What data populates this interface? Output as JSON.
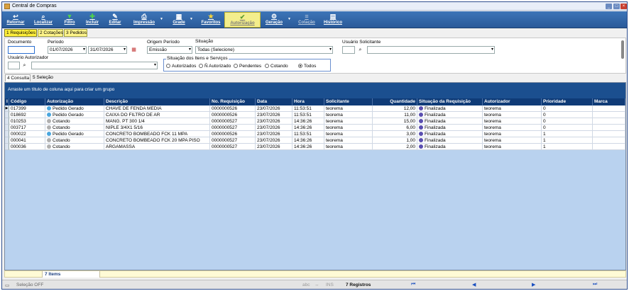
{
  "window": {
    "title": "Central de Compras"
  },
  "toolbar": {
    "items": [
      {
        "label": "Retornar",
        "icon": "return-icon"
      },
      {
        "label": "Localizar",
        "icon": "search-icon"
      },
      {
        "label": "Filtro",
        "icon": "filter-icon"
      },
      {
        "label": "Incluir",
        "icon": "add-icon"
      },
      {
        "label": "Editar",
        "icon": "edit-icon"
      },
      {
        "label": "Impressão",
        "icon": "print-icon"
      },
      {
        "label": "Grade",
        "icon": "grid-icon"
      },
      {
        "label": "Favoritos",
        "icon": "star-icon"
      },
      {
        "label": "Autorização",
        "icon": "authorization-icon"
      },
      {
        "label": "Geração",
        "icon": "generate-icon"
      },
      {
        "label": "Cotação",
        "icon": "quote-icon"
      },
      {
        "label": "Histórico",
        "icon": "history-icon"
      }
    ]
  },
  "tabs": [
    "1 Requisições",
    "2 Cotações",
    "3 Pedidos"
  ],
  "filters": {
    "documento_label": "Documento",
    "periodo_label": "Período",
    "date_from": "01/07/2026",
    "date_to": "31/07/2026",
    "origem_label": "Origem Período",
    "origem_value": "Emissão",
    "situacao_label": "Situação",
    "situacao_value": "Todas (Selecione)",
    "usuario_solicitante_label": "Usuário Solicitante",
    "usuario_autorizador_label": "Usuário Autorizador",
    "situacao_itens_label": "Situação dos Itens e Serviços",
    "radios": [
      "Autorizados",
      "Ñ Autorizado",
      "Pendentes",
      "Cotando",
      "Todos"
    ],
    "radio_selected": "Todos"
  },
  "subtabs": [
    "4 Consulta",
    "5 Seleção"
  ],
  "grid": {
    "group_hint": "Arraste um título de coluna aqui para criar um grupo",
    "columns": [
      "Código",
      "Autorização",
      "Descrição",
      "No. Requisição",
      "Data",
      "Hora",
      "Solicitante",
      "Quantidade",
      "Situação da Requisição",
      "Autorizador",
      "Prioridade",
      "Marca"
    ],
    "rows": [
      {
        "codigo": "017399",
        "autorizacao": "Pedido Gerado",
        "descricao": "CHAVE DE FENDA MEDIA",
        "requisicao": "0000000526",
        "data": "23/07/2026",
        "hora": "11:53:51",
        "solicitante": "teorema",
        "quantidade": "12,00",
        "situacao": "Finalizada",
        "autorizador": "teorema",
        "prioridade": "0",
        "marca": ""
      },
      {
        "codigo": "018692",
        "autorizacao": "Pedido Gerado",
        "descricao": "CAIXA DO FILTRO DE AR",
        "requisicao": "0000000526",
        "data": "23/07/2026",
        "hora": "11:53:51",
        "solicitante": "teorema",
        "quantidade": "11,00",
        "situacao": "Finalizada",
        "autorizador": "teorema",
        "prioridade": "0",
        "marca": ""
      },
      {
        "codigo": "010253",
        "autorizacao": "Cotando",
        "descricao": "MANG. PT 300 1/4",
        "requisicao": "0000000527",
        "data": "23/07/2026",
        "hora": "14:36:26",
        "solicitante": "teorema",
        "quantidade": "15,00",
        "situacao": "Finalizada",
        "autorizador": "teorema",
        "prioridade": "0",
        "marca": ""
      },
      {
        "codigo": "003717",
        "autorizacao": "Cotando",
        "descricao": "NIPLE 3/4X1 5/16",
        "requisicao": "0000000527",
        "data": "23/07/2026",
        "hora": "14:36:26",
        "solicitante": "teorema",
        "quantidade": "6,00",
        "situacao": "Finalizada",
        "autorizador": "teorema",
        "prioridade": "0",
        "marca": ""
      },
      {
        "codigo": "000022",
        "autorizacao": "Pedido Gerado",
        "descricao": "CONCRETO BOMBEADO FCK 11 MPA",
        "requisicao": "0000000526",
        "data": "23/07/2026",
        "hora": "11:53:51",
        "solicitante": "teorema",
        "quantidade": "3,00",
        "situacao": "Finalizada",
        "autorizador": "teorema",
        "prioridade": "1",
        "marca": ""
      },
      {
        "codigo": "000041",
        "autorizacao": "Cotando",
        "descricao": "CONCRETO BOMBEADO FCK 20 MPA PISO",
        "requisicao": "0000000527",
        "data": "23/07/2026",
        "hora": "14:36:26",
        "solicitante": "teorema",
        "quantidade": "1,00",
        "situacao": "Finalizada",
        "autorizador": "teorema",
        "prioridade": "1",
        "marca": ""
      },
      {
        "codigo": "000036",
        "autorizacao": "Cotando",
        "descricao": "ARGAMASSA",
        "requisicao": "0000000527",
        "data": "23/07/2026",
        "hora": "14:36:26",
        "solicitante": "teorema",
        "quantidade": "2,00",
        "situacao": "Finalizada",
        "autorizador": "teorema",
        "prioridade": "1",
        "marca": ""
      }
    ],
    "footer_count": "7 Items"
  },
  "statusbar": {
    "selecao": "Seleção OFF",
    "abc": "abc",
    "ins": "INS",
    "registros": "7 Registros"
  },
  "colors": {
    "accent": "#2a5a99",
    "highlight": "#f3ee8c",
    "grid_bg": "#b9d2ef"
  }
}
